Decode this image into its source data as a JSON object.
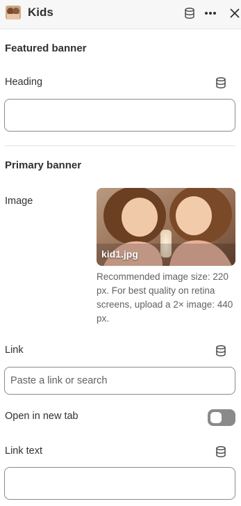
{
  "header": {
    "title": "Kids",
    "icons": [
      "thumbnail-image",
      "database-icon",
      "more-icon",
      "close-icon"
    ]
  },
  "featured_banner": {
    "title": "Featured banner",
    "heading_label": "Heading",
    "heading_value": ""
  },
  "primary_banner": {
    "title": "Primary banner",
    "image_label": "Image",
    "image_filename": "kid1.jpg",
    "image_help": "Recommended image size: 220 px. For best quality on retina screens, upload a 2× image: 440 px.",
    "link_label": "Link",
    "link_placeholder": "Paste a link or search",
    "link_value": "",
    "new_tab_label": "Open in new tab",
    "new_tab_enabled": false,
    "link_text_label": "Link text",
    "link_text_value": ""
  },
  "colors": {
    "header_bg": "#f7f7f7",
    "text": "#303030",
    "subdued_text": "#616161",
    "border": "#8a8a8a",
    "toggle_off": "#8a8a8a"
  }
}
